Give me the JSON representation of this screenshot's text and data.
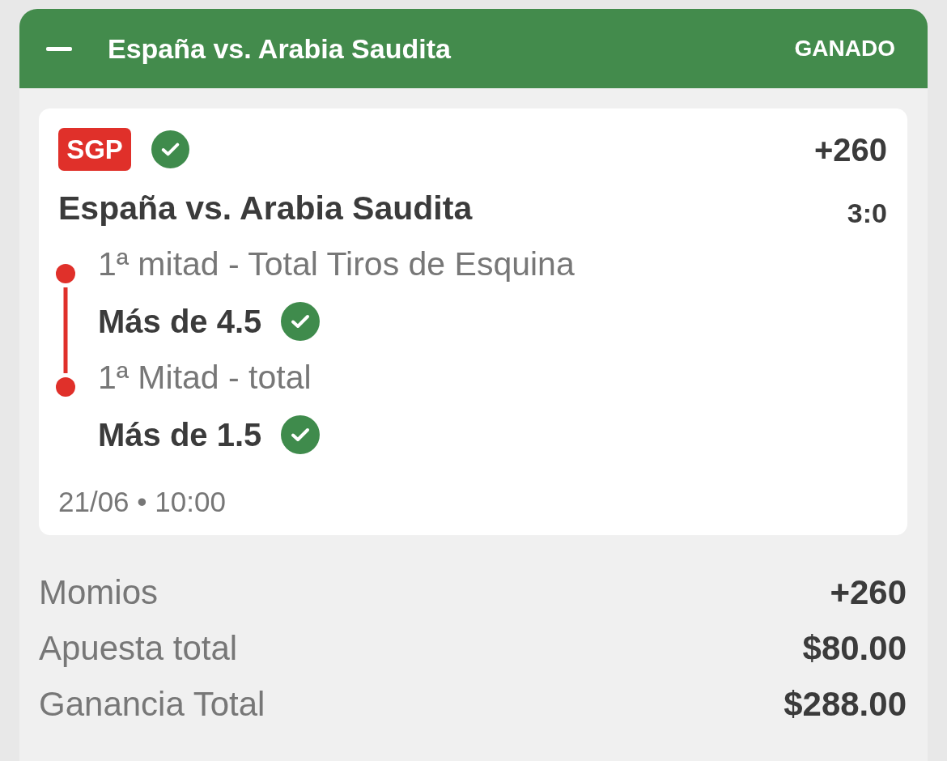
{
  "header": {
    "title": "España vs. Arabia Saudita",
    "status": "GANADO",
    "expanded": true
  },
  "bet": {
    "badge": "SGP",
    "won": true,
    "odds": "+260",
    "match": "España vs. Arabia Saudita",
    "score": "3:0",
    "legs": [
      {
        "market": "1ª mitad - Total Tiros de Esquina",
        "selection": "Más de 4.5",
        "won": true
      },
      {
        "market": "1ª Mitad - total",
        "selection": "Más de 1.5",
        "won": true
      }
    ],
    "datetime": "21/06 • 10:00"
  },
  "summary": [
    {
      "label": "Momios",
      "value": "+260"
    },
    {
      "label": "Apuesta total",
      "value": "$80.00"
    },
    {
      "label": "Ganancia Total",
      "value": "$288.00"
    }
  ]
}
